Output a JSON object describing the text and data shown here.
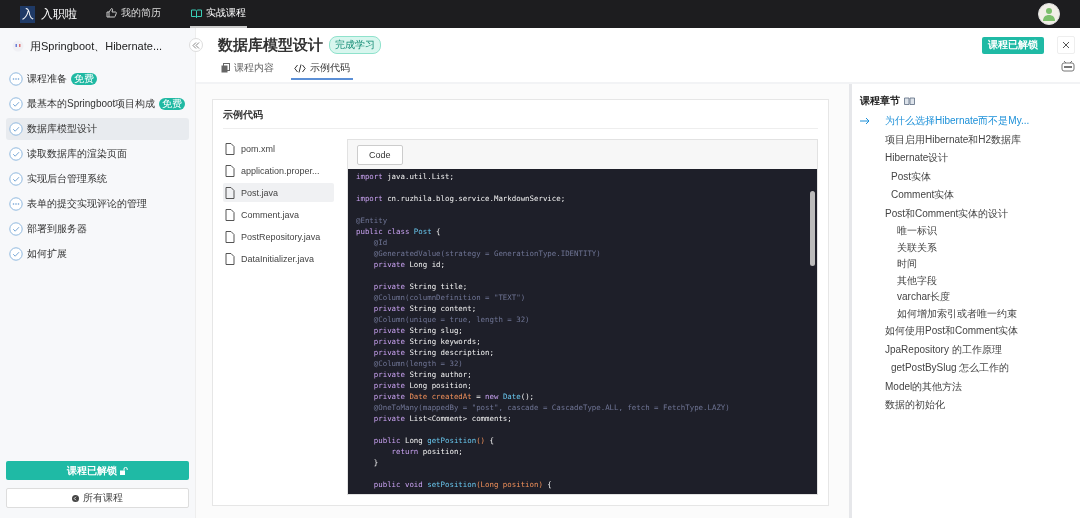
{
  "topbar": {
    "logo_mark": "入",
    "logo_text": "入职啦",
    "nav": [
      {
        "label": "我的简历",
        "selected": false
      },
      {
        "label": "实战课程",
        "selected": true
      }
    ]
  },
  "sidebar": {
    "course_title": "用Springboot、Hibernate...",
    "lessons": [
      {
        "label": "课程准备",
        "done": false,
        "badge": "免费",
        "selected": false
      },
      {
        "label": "最基本的Springboot项目构成",
        "done": true,
        "badge": "免费",
        "selected": false
      },
      {
        "label": "数据库模型设计",
        "done": true,
        "selected": true
      },
      {
        "label": "读取数据库的渲染页面",
        "done": true,
        "selected": false
      },
      {
        "label": "实现后台管理系统",
        "done": true,
        "selected": false
      },
      {
        "label": "表单的提交实现评论的管理",
        "done": false,
        "selected": false
      },
      {
        "label": "部署到服务器",
        "done": true,
        "selected": false
      },
      {
        "label": "如何扩展",
        "done": true,
        "selected": false
      }
    ],
    "unlock_button": "课程已解锁",
    "all_courses_button": "所有课程"
  },
  "header": {
    "title": "数据库模型设计",
    "status_badge": "完成学习",
    "tabs": [
      {
        "label": "课程内容",
        "selected": false
      },
      {
        "label": "示例代码",
        "selected": true
      }
    ],
    "unlock_button": "课程已解锁"
  },
  "code_card": {
    "title": "示例代码",
    "files": [
      {
        "name": "pom.xml",
        "selected": false
      },
      {
        "name": "application.proper...",
        "selected": false
      },
      {
        "name": "Post.java",
        "selected": true
      },
      {
        "name": "Comment.java",
        "selected": false
      },
      {
        "name": "PostRepository.java",
        "selected": false
      },
      {
        "name": "DataInitializer.java",
        "selected": false
      }
    ],
    "code_button": "Code",
    "lines": [
      {
        "blank_before": false,
        "tokens": [
          {
            "kind": "keyword",
            "text": "import"
          },
          {
            "kind": "plain",
            "text": " java.util.List;"
          }
        ]
      },
      {
        "blank_before": true,
        "tokens": [
          {
            "kind": "keyword",
            "text": "import"
          },
          {
            "kind": "plain",
            "text": " cn.ruzhila.blog.service.MarkdownService;"
          }
        ]
      },
      {
        "blank_before": true,
        "tokens": [
          {
            "kind": "annotation",
            "text": "@Entity"
          }
        ]
      },
      {
        "blank_before": false,
        "tokens": [
          {
            "kind": "keyword",
            "text": "public class "
          },
          {
            "kind": "name",
            "text": "Post"
          },
          {
            "kind": "plain",
            "text": " {"
          }
        ]
      },
      {
        "blank_before": false,
        "tokens": [
          {
            "kind": "annotation",
            "text": "    @Id"
          }
        ]
      },
      {
        "blank_before": false,
        "tokens": [
          {
            "kind": "annotation",
            "text": "    @GeneratedValue(strategy = GenerationType.IDENTITY)"
          }
        ]
      },
      {
        "blank_before": false,
        "tokens": [
          {
            "kind": "keyword",
            "text": "    private"
          },
          {
            "kind": "plain",
            "text": " Long id;"
          }
        ]
      },
      {
        "blank_before": true,
        "tokens": [
          {
            "kind": "keyword",
            "text": "    private"
          },
          {
            "kind": "plain",
            "text": " String title;"
          }
        ]
      },
      {
        "blank_before": false,
        "tokens": [
          {
            "kind": "annotation",
            "text": "    @Column(columnDefinition = \"TEXT\")"
          }
        ]
      },
      {
        "blank_before": false,
        "tokens": [
          {
            "kind": "keyword",
            "text": "    private"
          },
          {
            "kind": "plain",
            "text": " String content;"
          }
        ]
      },
      {
        "blank_before": false,
        "tokens": [
          {
            "kind": "annotation",
            "text": "    @Column(unique = true, length = 32)"
          }
        ]
      },
      {
        "blank_before": false,
        "tokens": [
          {
            "kind": "keyword",
            "text": "    private"
          },
          {
            "kind": "plain",
            "text": " String slug;"
          }
        ]
      },
      {
        "blank_before": false,
        "tokens": [
          {
            "kind": "keyword",
            "text": "    private"
          },
          {
            "kind": "plain",
            "text": " String keywords;"
          }
        ]
      },
      {
        "blank_before": false,
        "tokens": [
          {
            "kind": "keyword",
            "text": "    private"
          },
          {
            "kind": "plain",
            "text": " String description;"
          }
        ]
      },
      {
        "blank_before": false,
        "tokens": [
          {
            "kind": "annotation",
            "text": "    @Column(length = 32)"
          }
        ]
      },
      {
        "blank_before": false,
        "tokens": [
          {
            "kind": "keyword",
            "text": "    private"
          },
          {
            "kind": "plain",
            "text": " String author;"
          }
        ]
      },
      {
        "blank_before": false,
        "tokens": [
          {
            "kind": "keyword",
            "text": "    private"
          },
          {
            "kind": "plain",
            "text": " Long position;"
          }
        ]
      },
      {
        "blank_before": false,
        "tokens": [
          {
            "kind": "keyword",
            "text": "    private "
          },
          {
            "kind": "variable",
            "text": "Date createdAt"
          },
          {
            "kind": "plain",
            "text": " = "
          },
          {
            "kind": "keyword",
            "text": "new "
          },
          {
            "kind": "name",
            "text": "Date"
          },
          {
            "kind": "plain",
            "text": "();"
          }
        ]
      },
      {
        "blank_before": false,
        "tokens": [
          {
            "kind": "annotation",
            "text": "    @OneToMany(mappedBy = \"post\", cascade = CascadeType.ALL, fetch = FetchType.LAZY)"
          }
        ]
      },
      {
        "blank_before": false,
        "tokens": [
          {
            "kind": "keyword",
            "text": "    private"
          },
          {
            "kind": "plain",
            "text": " List<Comment> comments;"
          }
        ]
      },
      {
        "blank_before": true,
        "tokens": [
          {
            "kind": "keyword",
            "text": "    public"
          },
          {
            "kind": "plain",
            "text": " Long "
          },
          {
            "kind": "name",
            "text": "getPosition"
          },
          {
            "kind": "variable",
            "text": "()"
          },
          {
            "kind": "plain",
            "text": " {"
          }
        ]
      },
      {
        "blank_before": false,
        "tokens": [
          {
            "kind": "keyword",
            "text": "        return"
          },
          {
            "kind": "plain",
            "text": " position;"
          }
        ]
      },
      {
        "blank_before": false,
        "tokens": [
          {
            "kind": "plain",
            "text": "    }"
          }
        ]
      },
      {
        "blank_before": true,
        "tokens": [
          {
            "kind": "keyword",
            "text": "    public void "
          },
          {
            "kind": "name",
            "text": "setPosition"
          },
          {
            "kind": "variable",
            "text": "(Long position)"
          },
          {
            "kind": "plain",
            "text": " {"
          }
        ]
      }
    ]
  },
  "toc": {
    "title": "课程章节",
    "items": [
      {
        "label": "为什么选择Hibernate而不是My...",
        "selected": true
      },
      {
        "label": "项目启用Hibernate和H2数据库",
        "selected": false
      },
      {
        "label": "Hibernate设计",
        "selected": false,
        "children": [
          {
            "label": "Post实体",
            "selected": false
          },
          {
            "label": "Comment实体",
            "selected": false
          }
        ]
      },
      {
        "label": "Post和Comment实体的设计",
        "selected": false,
        "children": [
          {
            "label": "唯一标识",
            "selected": false
          },
          {
            "label": "关联关系",
            "selected": false
          },
          {
            "label": "时间",
            "selected": false
          },
          {
            "label": "其他字段",
            "selected": false
          },
          {
            "label": "varchar长度",
            "selected": false
          },
          {
            "label": "如何增加索引或者唯一约束",
            "selected": false
          }
        ]
      },
      {
        "label": "如何使用Post和Comment实体",
        "selected": false
      },
      {
        "label": "JpaRepository 的工作原理",
        "selected": false,
        "children": [
          {
            "label": "getPostBySlug 怎么工作的",
            "selected": false
          }
        ]
      },
      {
        "label": "Model的其他方法",
        "selected": false
      },
      {
        "label": "数据的初始化",
        "selected": false
      }
    ]
  }
}
